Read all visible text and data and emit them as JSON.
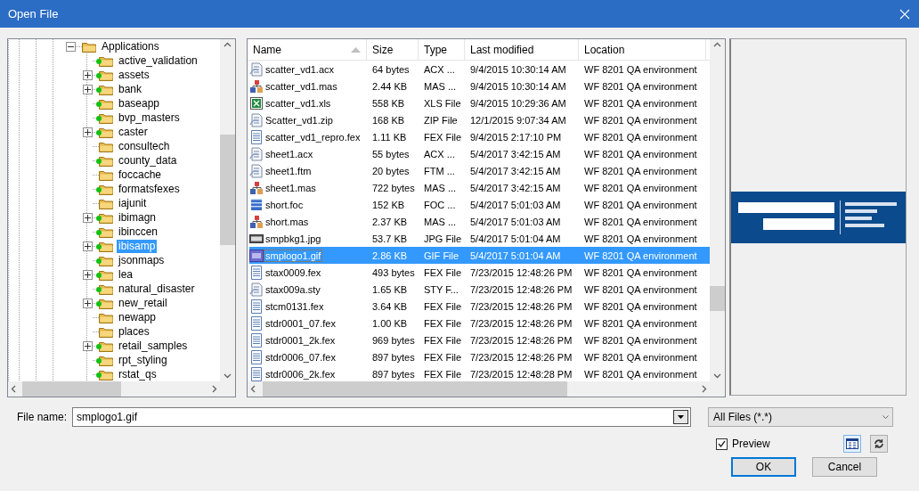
{
  "window": {
    "title": "Open File"
  },
  "tree": {
    "label": "Applications",
    "expandable": true,
    "expanded": true,
    "active": false,
    "selected": false,
    "children": [
      {
        "label": "active_validation",
        "expandable": false,
        "active": true,
        "selected": false
      },
      {
        "label": "assets",
        "expandable": true,
        "active": true,
        "selected": false
      },
      {
        "label": "bank",
        "expandable": true,
        "active": true,
        "selected": false
      },
      {
        "label": "baseapp",
        "expandable": false,
        "active": true,
        "selected": false
      },
      {
        "label": "bvp_masters",
        "expandable": false,
        "active": true,
        "selected": false
      },
      {
        "label": "caster",
        "expandable": true,
        "active": true,
        "selected": false
      },
      {
        "label": "consultech",
        "expandable": false,
        "active": false,
        "selected": false
      },
      {
        "label": "county_data",
        "expandable": false,
        "active": true,
        "selected": false
      },
      {
        "label": "foccache",
        "expandable": false,
        "active": false,
        "selected": false
      },
      {
        "label": "formatsfexes",
        "expandable": false,
        "active": true,
        "selected": false
      },
      {
        "label": "iajunit",
        "expandable": false,
        "active": false,
        "selected": false
      },
      {
        "label": "ibimagn",
        "expandable": true,
        "active": true,
        "selected": false
      },
      {
        "label": "ibinccen",
        "expandable": false,
        "active": true,
        "selected": false
      },
      {
        "label": "ibisamp",
        "expandable": true,
        "active": true,
        "selected": true
      },
      {
        "label": "jsonmaps",
        "expandable": false,
        "active": true,
        "selected": false
      },
      {
        "label": "lea",
        "expandable": true,
        "active": true,
        "selected": false
      },
      {
        "label": "natural_disaster",
        "expandable": false,
        "active": true,
        "selected": false
      },
      {
        "label": "new_retail",
        "expandable": true,
        "active": true,
        "selected": false
      },
      {
        "label": "newapp",
        "expandable": false,
        "active": false,
        "selected": false
      },
      {
        "label": "places",
        "expandable": false,
        "active": false,
        "selected": false
      },
      {
        "label": "retail_samples",
        "expandable": true,
        "active": true,
        "selected": false
      },
      {
        "label": "rpt_styling",
        "expandable": false,
        "active": true,
        "selected": false
      },
      {
        "label": "rstat_qs",
        "expandable": false,
        "active": true,
        "selected": false
      }
    ]
  },
  "file_list": {
    "columns": [
      {
        "label": "Name",
        "sorted": true
      },
      {
        "label": "Size",
        "sorted": false
      },
      {
        "label": "Type",
        "sorted": false
      },
      {
        "label": "Last modified",
        "sorted": false
      },
      {
        "label": "Location",
        "sorted": false
      }
    ],
    "rows": [
      {
        "kind": "script",
        "cells": [
          "scatter_vd1.acx",
          "64 bytes",
          "ACX ...",
          "9/4/2015 10:30:14 AM",
          "WF 8201 QA environment"
        ],
        "selected": false
      },
      {
        "kind": "master",
        "cells": [
          "scatter_vd1.mas",
          "2.44 KB",
          "MAS ...",
          "9/4/2015 10:30:14 AM",
          "WF 8201 QA environment"
        ],
        "selected": false
      },
      {
        "kind": "sheet",
        "cells": [
          "scatter_vd1.xls",
          "558 KB",
          "XLS File",
          "9/4/2015 10:29:36 AM",
          "WF 8201 QA environment"
        ],
        "selected": false
      },
      {
        "kind": "script",
        "cells": [
          "Scatter_vd1.zip",
          "168 KB",
          "ZIP File",
          "12/1/2015 9:07:34 AM",
          "WF 8201 QA environment"
        ],
        "selected": false
      },
      {
        "kind": "text",
        "cells": [
          "scatter_vd1_repro.fex",
          "1.11 KB",
          "FEX File",
          "9/4/2015 2:17:10 PM",
          "WF 8201 QA environment"
        ],
        "selected": false
      },
      {
        "kind": "script",
        "cells": [
          "sheet1.acx",
          "55 bytes",
          "ACX ...",
          "5/4/2017 3:42:15 AM",
          "WF 8201 QA environment"
        ],
        "selected": false
      },
      {
        "kind": "script",
        "cells": [
          "sheet1.ftm",
          "20 bytes",
          "FTM ...",
          "5/4/2017 3:42:15 AM",
          "WF 8201 QA environment"
        ],
        "selected": false
      },
      {
        "kind": "master",
        "cells": [
          "sheet1.mas",
          "722 bytes",
          "MAS ...",
          "5/4/2017 3:42:15 AM",
          "WF 8201 QA environment"
        ],
        "selected": false
      },
      {
        "kind": "database",
        "cells": [
          "short.foc",
          "152 KB",
          "FOC ...",
          "5/4/2017 5:01:03 AM",
          "WF 8201 QA environment"
        ],
        "selected": false
      },
      {
        "kind": "master",
        "cells": [
          "short.mas",
          "2.37 KB",
          "MAS ...",
          "5/4/2017 5:01:03 AM",
          "WF 8201 QA environment"
        ],
        "selected": false
      },
      {
        "kind": "jpeg",
        "cells": [
          "smpbkg1.jpg",
          "53.7 KB",
          "JPG File",
          "5/4/2017 5:01:04 AM",
          "WF 8201 QA environment"
        ],
        "selected": false
      },
      {
        "kind": "gif",
        "cells": [
          "smplogo1.gif",
          "2.86 KB",
          "GIF File",
          "5/4/2017 5:01:04 AM",
          "WF 8201 QA environment"
        ],
        "selected": true
      },
      {
        "kind": "text",
        "cells": [
          "stax0009.fex",
          "493 bytes",
          "FEX File",
          "7/23/2015 12:48:26 PM",
          "WF 8201 QA environment"
        ],
        "selected": false
      },
      {
        "kind": "script",
        "cells": [
          "stax009a.sty",
          "1.65 KB",
          "STY F...",
          "7/23/2015 12:48:26 PM",
          "WF 8201 QA environment"
        ],
        "selected": false
      },
      {
        "kind": "text",
        "cells": [
          "stcm0131.fex",
          "3.64 KB",
          "FEX File",
          "7/23/2015 12:48:26 PM",
          "WF 8201 QA environment"
        ],
        "selected": false
      },
      {
        "kind": "text",
        "cells": [
          "stdr0001_07.fex",
          "1.00 KB",
          "FEX File",
          "7/23/2015 12:48:26 PM",
          "WF 8201 QA environment"
        ],
        "selected": false
      },
      {
        "kind": "text",
        "cells": [
          "stdr0001_2k.fex",
          "969 bytes",
          "FEX File",
          "7/23/2015 12:48:26 PM",
          "WF 8201 QA environment"
        ],
        "selected": false
      },
      {
        "kind": "text",
        "cells": [
          "stdr0006_07.fex",
          "897 bytes",
          "FEX File",
          "7/23/2015 12:48:26 PM",
          "WF 8201 QA environment"
        ],
        "selected": false
      },
      {
        "kind": "text",
        "cells": [
          "stdr0006_2k.fex",
          "897 bytes",
          "FEX File",
          "7/23/2015 12:48:28 PM",
          "WF 8201 QA environment"
        ],
        "selected": false
      }
    ]
  },
  "file_name": {
    "label": "File name:",
    "value": "smplogo1.gif"
  },
  "filter": {
    "value": "All Files (*.*)"
  },
  "preview_option": {
    "label": "Preview",
    "checked": true
  },
  "view_buttons": [
    {
      "kind": "details",
      "selected": true
    },
    {
      "kind": "refresh",
      "selected": false
    }
  ],
  "buttons": [
    {
      "label": "OK",
      "default": true
    },
    {
      "label": "Cancel",
      "default": false
    }
  ]
}
